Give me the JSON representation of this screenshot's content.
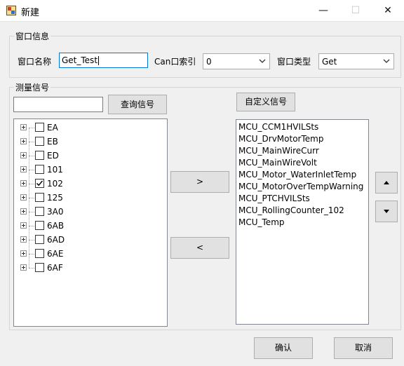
{
  "window": {
    "title": "新建",
    "minimize": "—",
    "maximize": "☐",
    "close": "✕"
  },
  "window_group": {
    "title": "窗口信息",
    "name_label": "窗口名称",
    "name_value": "Get_Test",
    "can_index_label": "Can口索引",
    "can_index_value": "0",
    "type_label": "窗口类型",
    "type_value": "Get"
  },
  "signal_group": {
    "title": "测量信号",
    "search_value": "",
    "search_button": "查询信号",
    "custom_button": "自定义信号",
    "add_button": ">",
    "remove_button": "<",
    "tree": [
      {
        "label": "EA",
        "checked": false
      },
      {
        "label": "EB",
        "checked": false
      },
      {
        "label": "ED",
        "checked": false
      },
      {
        "label": "101",
        "checked": false
      },
      {
        "label": "102",
        "checked": true
      },
      {
        "label": "125",
        "checked": false
      },
      {
        "label": "3A0",
        "checked": false
      },
      {
        "label": "6AB",
        "checked": false
      },
      {
        "label": "6AD",
        "checked": false
      },
      {
        "label": "6AE",
        "checked": false
      },
      {
        "label": "6AF",
        "checked": false
      }
    ],
    "selected_signals": [
      "MCU_CCM1HVILSts",
      "MCU_DrvMotorTemp",
      "MCU_MainWireCurr",
      "MCU_MainWireVolt",
      "MCU_Motor_WaterInletTemp",
      "MCU_MotorOverTempWarning",
      "MCU_PTCHVILSts",
      "MCU_RollingCounter_102",
      "MCU_Temp"
    ]
  },
  "footer": {
    "ok_button": "确认",
    "cancel_button": "取消"
  }
}
